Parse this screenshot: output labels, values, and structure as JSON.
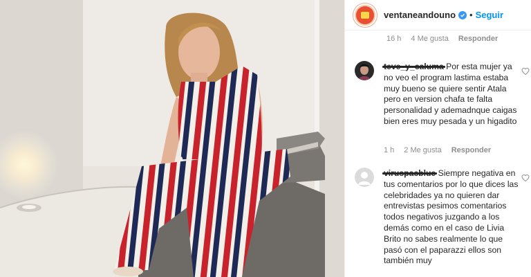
{
  "post": {
    "username": "ventaneandouno",
    "separator": "•",
    "follow_label": "Seguir"
  },
  "top_meta": {
    "time": "16 h",
    "likes": "4 Me gusta",
    "reply": "Responder"
  },
  "comments": [
    {
      "user": "teve_y_caluma",
      "text": "Por esta mujer ya no veo el program lastima estaba muy bueno se quiere sentir Atala pero en version chafa te falta personalidad y ademadnque caigas bien eres muy pesada y un higadito",
      "time": "1 h",
      "likes": "2 Me gusta",
      "reply": "Responder"
    },
    {
      "user": "viruspacblue",
      "text": "Siempre negativa en tus comentarios por lo que dices las celebridades ya no quieren dar entrevistas pesimos comentarios todos negativos juzgando a los demás como en el caso de Livia Brito no sabes realmente lo que pasó con el paparazzi ellos son también muy"
    }
  ],
  "colors": {
    "link": "#0095f6",
    "verified": "#3897f0",
    "muted": "#8e8e8e",
    "text": "#262626"
  },
  "icons": [
    "verified-badge-icon",
    "heart-icon",
    "default-avatar-icon"
  ]
}
